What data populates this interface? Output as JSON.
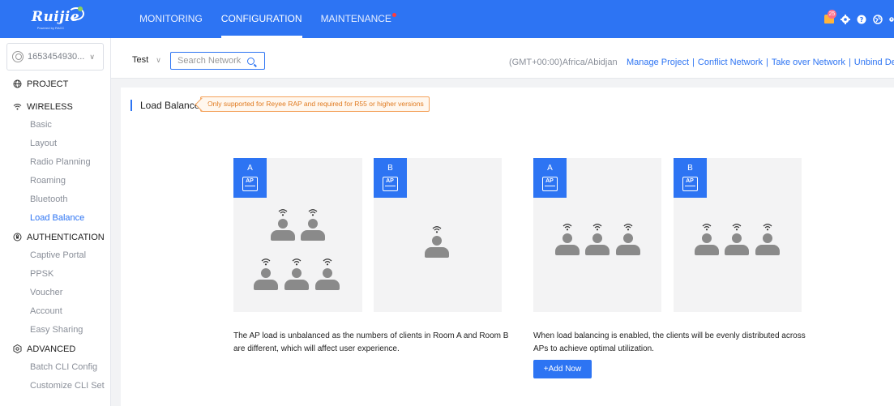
{
  "brand": {
    "logo_text": "Ruijie",
    "logo_sub": "Powered by RACC"
  },
  "topnav": {
    "items": [
      {
        "label": "MONITORING"
      },
      {
        "label": "CONFIGURATION"
      },
      {
        "label": "MAINTENANCE"
      }
    ],
    "active": "CONFIGURATION",
    "notification_count": "25"
  },
  "sidebar": {
    "account": "1653454930...",
    "project_label": "PROJECT",
    "groups": [
      {
        "label": "WIRELESS",
        "items": [
          "Basic",
          "Layout",
          "Radio Planning",
          "Roaming",
          "Bluetooth",
          "Load Balance"
        ]
      },
      {
        "label": "AUTHENTICATION",
        "items": [
          "Captive Portal",
          "PPSK",
          "Voucher",
          "Account",
          "Easy Sharing"
        ]
      },
      {
        "label": "ADVANCED",
        "items": [
          "Batch CLI Config",
          "Customize CLI Set"
        ]
      }
    ],
    "active_item": "Load Balance"
  },
  "toolbar": {
    "project": "Test",
    "search_placeholder": "Search Network",
    "timezone": "(GMT+00:00)Africa/Abidjan",
    "links": [
      "Manage Project",
      "Conflict Network",
      "Take over Network",
      "Unbind Devic"
    ]
  },
  "page": {
    "title": "Load Balance",
    "notice": "Only supported for Reyee RAP and required for R55 or higher versions",
    "rooms": [
      {
        "letter": "A",
        "ap_label": "AP"
      },
      {
        "letter": "B",
        "ap_label": "AP"
      },
      {
        "letter": "A",
        "ap_label": "AP"
      },
      {
        "letter": "B",
        "ap_label": "AP"
      }
    ],
    "unbalanced_text": "The AP load is unbalanced as the numbers of clients in Room A and Room B are different, which will affect user experience.",
    "balanced_text": "When load balancing is enabled, the clients will be evenly distributed across APs to achieve optimal utilization.",
    "add_button": "+Add Now"
  }
}
